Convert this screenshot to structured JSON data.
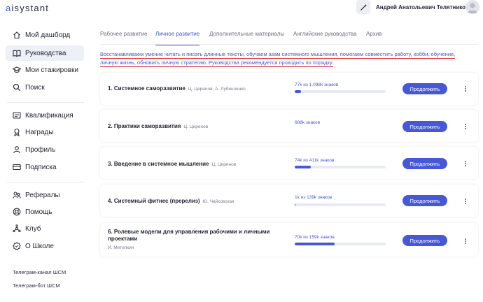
{
  "header": {
    "logo_prefix": "a",
    "logo_rest": "isystant",
    "user_name": "Андрей Анатольевич Телятников"
  },
  "sidebar": {
    "items": [
      {
        "label": "Мой дашборд",
        "icon": "home-icon"
      },
      {
        "label": "Руководства",
        "icon": "book-icon",
        "active": true
      },
      {
        "label": "Мои стажировки",
        "icon": "graduation-cap-icon"
      },
      {
        "label": "Поиск",
        "icon": "search-icon"
      },
      {
        "label": "Квалификация",
        "icon": "qualification-icon"
      },
      {
        "label": "Награды",
        "icon": "award-icon"
      },
      {
        "label": "Профиль",
        "icon": "user-icon"
      },
      {
        "label": "Подписка",
        "icon": "card-icon"
      },
      {
        "label": "Рефералы",
        "icon": "referrals-icon"
      },
      {
        "label": "Помощь",
        "icon": "help-icon"
      },
      {
        "label": "Клуб",
        "icon": "club-icon"
      },
      {
        "label": "О Школе",
        "icon": "info-icon"
      }
    ],
    "links": [
      "Телеграм-канал ШСМ",
      "Телеграм-бот ШСМ"
    ]
  },
  "tabs": [
    {
      "label": "Рабочее развитие"
    },
    {
      "label": "Личное развитие",
      "active": true
    },
    {
      "label": "Дополнительные материалы"
    },
    {
      "label": "Английские руководства"
    },
    {
      "label": "Архив"
    }
  ],
  "intro": "Восстанавливаем умение читать и писать длинные тексты, обучаем азам системного мышления, помогаем совместить работу, хобби, обучение, личную жизнь, обновить личную стратегию. Руководства рекомендуется проходить по порядку.",
  "courses": [
    {
      "title": "1. Системное саморазвитие",
      "authors": "Ц. Церенов, А. Лубенченко",
      "progress_text": "77k из 1.098k знаков",
      "progress": 0.07,
      "button": "Продолжить"
    },
    {
      "title": "2. Практики саморазвития",
      "authors": "Ц. Церенов",
      "progress_text": "688k знаков",
      "progress": 0,
      "button": "Продолжить"
    },
    {
      "title": "3. Введение в системное мышление",
      "authors": "Ц. Церенов",
      "progress_text": "74k из 411k знаков",
      "progress": 0.18,
      "button": "Продолжить"
    },
    {
      "title": "4. Системный фитнес (пререлиз)",
      "authors": "Ю. Чайковская",
      "progress_text": "1k из 139k знаков",
      "progress": 0.01,
      "button": "Продолжить"
    },
    {
      "title": "6. Ролевые модели для управления рабочими и личными проектами",
      "title_line1": "6. Ролевые модели для управления рабочими и личными",
      "title_line2": "проектами",
      "authors": "И. Метелкин",
      "progress_text": "70k из 159k знаков",
      "progress": 0.44,
      "button": "Продолжить"
    }
  ],
  "colors": {
    "accent": "#4658d4",
    "underline": "#e2262a"
  }
}
